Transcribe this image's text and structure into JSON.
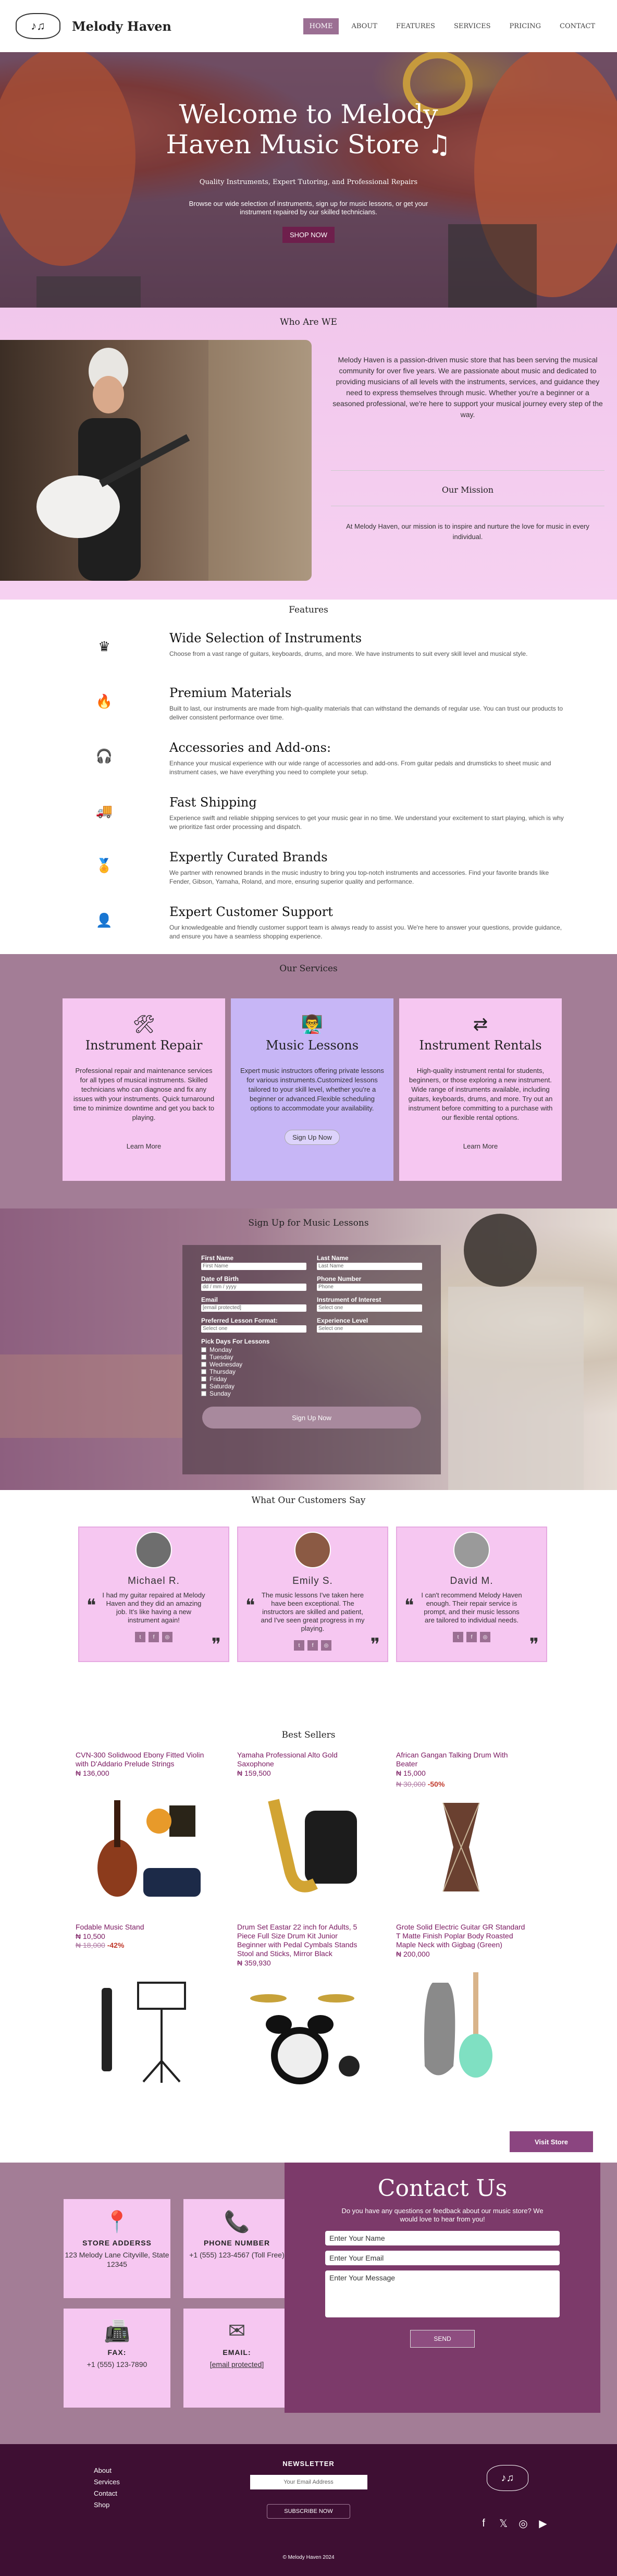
{
  "header": {
    "brand": "Melody Haven",
    "logo_icon": "music-logo-icon",
    "nav": [
      "HOME",
      "ABOUT",
      "FEATURES",
      "SERVICES",
      "PRICING",
      "CONTACT"
    ]
  },
  "hero": {
    "title": "Welcome to Melody Haven Music Store ♫",
    "tagline": "Quality Instruments, Expert Tutoring, and Professional Repairs",
    "description": "Browse our wide selection of instruments, sign up for music lessons, or get your instrument repaired by our skilled technicians.",
    "button": "SHOP NOW"
  },
  "who": {
    "title": "Who Are WE",
    "text": "Melody Haven is a passion-driven music store that has been serving the musical community for over five years. We are passionate about music and dedicated to providing musicians of all levels with the instruments, services, and guidance they need to express themselves through music. Whether you're a beginner or a seasoned professional, we're here to support your musical journey every step of the way.",
    "mission_title": "Our Mission",
    "mission_text": "At Melody Haven, our mission is to inspire and nurture the love for music in every individual."
  },
  "features": {
    "title": "Features",
    "items": [
      {
        "icon": "instruments-icon",
        "title": "Wide Selection of Instruments",
        "text": "Choose from a vast range of guitars, keyboards, drums, and more. We have instruments to suit every skill level and musical style."
      },
      {
        "icon": "fire-icon",
        "title": "Premium Materials",
        "text": "Built to last, our instruments are made from high-quality materials that can withstand the demands of regular use. You can trust our products to deliver consistent performance over time."
      },
      {
        "icon": "headphones-icon",
        "title": "Accessories and Add-ons:",
        "text": "Enhance your musical experience with our wide range of accessories and add-ons. From guitar pedals and drumsticks to sheet music and instrument cases, we have everything you need to complete your setup."
      },
      {
        "icon": "truck-icon",
        "title": "Fast Shipping",
        "text": "Experience swift and reliable shipping services to get your music gear in no time. We understand your excitement to start playing, which is why we prioritize fast order processing and dispatch."
      },
      {
        "icon": "medal-icon",
        "title": "Expertly Curated Brands",
        "text": "We partner with renowned brands in the music industry to bring you top-notch instruments and accessories. Find your favorite brands like Fender, Gibson, Yamaha, Roland, and more, ensuring superior quality and performance."
      },
      {
        "icon": "user-check-icon",
        "title": "Expert Customer Support",
        "text": "Our knowledgeable and friendly customer support team is always ready to assist you. We're here to answer your questions, provide guidance, and ensure you have a seamless shopping experience."
      }
    ]
  },
  "services": {
    "title": "Our Services",
    "cards": [
      {
        "icon": "tools-icon",
        "title": "Instrument Repair",
        "text": "Professional repair and maintenance services for all types of musical instruments. Skilled technicians who can diagnose and fix any issues with your instruments. Quick turnaround time to minimize downtime and get you back to playing.",
        "link": "Learn More"
      },
      {
        "icon": "teacher-icon",
        "title": "Music Lessons",
        "text": "Expert music instructors offering private lessons for various instruments.Customized lessons tailored to your skill level, whether you're a beginner or advanced.Flexible scheduling options to accommodate your availability.",
        "link": "Sign Up Now"
      },
      {
        "icon": "exchange-icon",
        "title": "Instrument Rentals",
        "text": "High-quality instrument rental for students, beginners, or those exploring a new instrument. Wide range of instruments available, including guitars, keyboards, drums, and more. Try out an instrument before committing to a purchase with our flexible rental options.",
        "link": "Learn More"
      }
    ]
  },
  "signup": {
    "title": "Sign Up for Music Lessons",
    "first_name_label": "First Name",
    "first_name_ph": "First Name",
    "last_name_label": "Last Name",
    "last_name_ph": "Last Name",
    "dob_label": "Date of Birth",
    "dob_ph": "dd / mm / yyyy",
    "phone_label": "Phone Number",
    "phone_ph": "Phone",
    "email_label": "Email",
    "email_ph": "[email protected]",
    "instrument_label": "Instrument of Interest",
    "instrument_ph": "Select one",
    "format_label": "Preferred Lesson Format:",
    "format_ph": "Select one",
    "level_label": "Experience Level",
    "level_ph": "Select one",
    "days_label": "Pick Days For Lessons",
    "days": [
      "Monday",
      "Tuesday",
      "Wednesday",
      "Thursday",
      "Friday",
      "Saturday",
      "Sunday"
    ],
    "button": "Sign Up Now"
  },
  "testimonials": {
    "title": "What Our Customers Say",
    "items": [
      {
        "name": "Michael R.",
        "text": "I had my guitar repaired at Melody Haven and they did an amazing job. It's like having a new instrument again!"
      },
      {
        "name": "Emily S.",
        "text": "The music lessons I've taken here have been exceptional. The instructors are skilled and patient, and I've seen great progress in my playing."
      },
      {
        "name": "David M.",
        "text": "I can't recommend Melody Haven enough. Their repair service is prompt, and their music lessons are tailored to individual needs."
      }
    ]
  },
  "best": {
    "title": "Best Sellers",
    "products": [
      {
        "title": "CVN-300 Solidwood Ebony Fitted Violin with D'Addario Prelude Strings",
        "price": "₦ 136,000",
        "old": "",
        "disc": "",
        "img": "violin"
      },
      {
        "title": "Yamaha Professional Alto Gold Saxophone",
        "price": "₦ 159,500",
        "old": "",
        "disc": "",
        "img": "sax"
      },
      {
        "title": "African Gangan Talking Drum With Beater",
        "price": "₦ 15,000",
        "old": "₦ 30,000",
        "disc": "-50%",
        "img": "talkingdrum"
      },
      {
        "title": "Fodable Music Stand",
        "price": "₦ 10,500",
        "old": "₦ 18,000",
        "disc": "-42%",
        "img": "stand"
      },
      {
        "title": "Drum Set Eastar 22 inch for Adults, 5 Piece Full Size Drum Kit Junior Beginner with Pedal Cymbals Stands Stool and Sticks, Mirror Black",
        "price": "₦ 359,930",
        "old": "",
        "disc": "",
        "img": "drumset"
      },
      {
        "title": "Grote Solid Electric Guitar GR Standard T Matte Finish Poplar Body Roasted Maple Neck with Gigbag (Green)",
        "price": "₦ 200,000",
        "old": "",
        "disc": "",
        "img": "guitar"
      }
    ],
    "visit": "Visit Store"
  },
  "contact": {
    "address_title": "STORE ADDERSS",
    "address": "123 Melody Lane Cityville, State 12345",
    "phone_title": "PHONE NUMBER",
    "phone": "+1 (555) 123-4567 (Toll Free)",
    "fax_title": "FAX:",
    "fax": "+1 (555) 123-7890",
    "email_title": "EMAIL:",
    "email": "[email protected]",
    "form_title": "Contact Us",
    "form_desc": "Do you have any questions or feedback about our music store? We would love to hear from you!",
    "name_ph": "Enter Your Name",
    "email_ph": "Enter Your Email",
    "msg_ph": "Enter Your Message",
    "send": "SEND"
  },
  "footer": {
    "links": [
      "About",
      "Services",
      "Contact",
      "Shop"
    ],
    "newsletter": "NEWSLETTER",
    "email_ph": "Your Email Address",
    "subscribe": "SUBSCRIBE NOW",
    "copy": "© Melody Haven 2024"
  }
}
